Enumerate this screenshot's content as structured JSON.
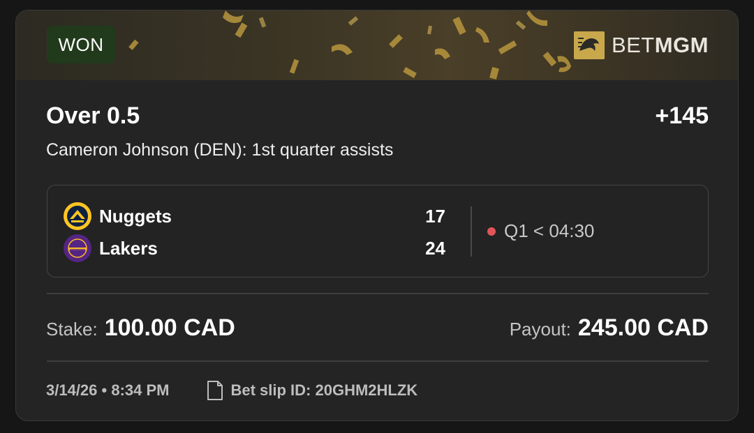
{
  "status_badge": "WON",
  "brand": {
    "prefix": "BET",
    "suffix": "MGM"
  },
  "bet": {
    "title": "Over 0.5",
    "odds": "+145",
    "description": "Cameron Johnson (DEN): 1st quarter assists"
  },
  "game": {
    "teams": [
      {
        "name": "Nuggets",
        "score": "17",
        "logo_icon": "nuggets-logo-icon"
      },
      {
        "name": "Lakers",
        "score": "24",
        "logo_icon": "lakers-logo-icon"
      }
    ],
    "live_status": "Q1 < 04:30"
  },
  "stake": {
    "label": "Stake:",
    "value": "100.00 CAD"
  },
  "payout": {
    "label": "Payout:",
    "value": "245.00 CAD"
  },
  "footer": {
    "date": "3/14/26 • 8:34 PM",
    "bet_slip": "Bet slip ID: 20GHM2HLZK"
  },
  "colors": {
    "won_badge_bg": "#213a1b",
    "card_bg": "#242424",
    "live_dot": "#e0555a",
    "gold": "#c9a84c"
  }
}
